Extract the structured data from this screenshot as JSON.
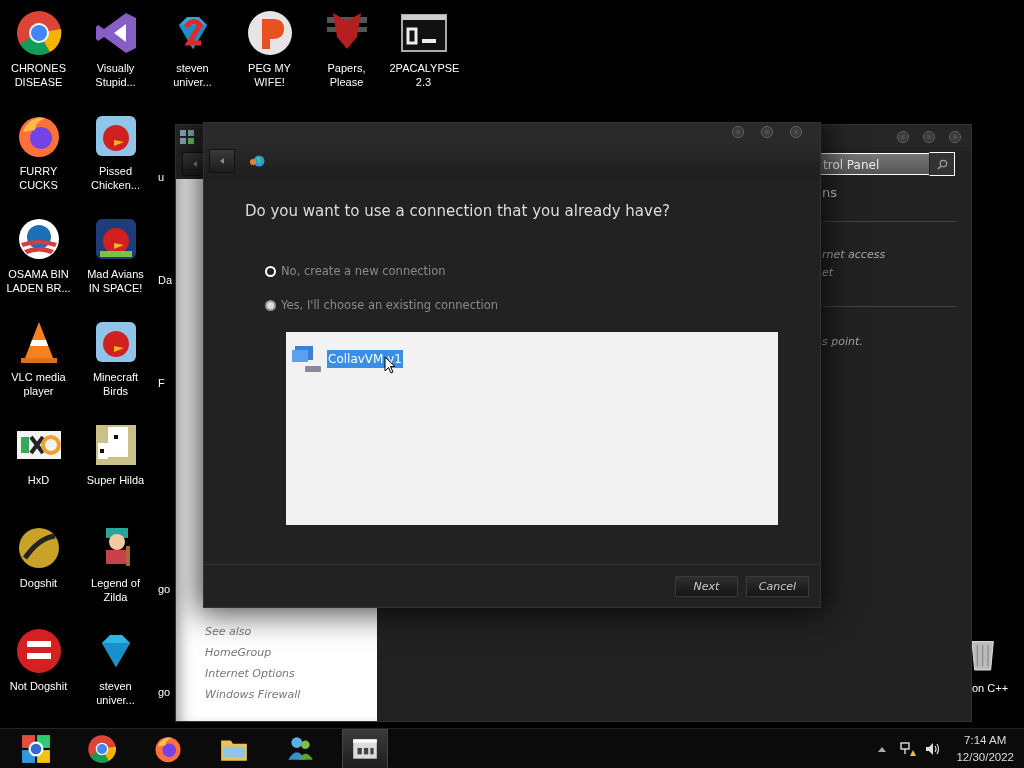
{
  "desktop": {
    "columns": [
      {
        "icons": [
          {
            "kind": "browser",
            "label": "CHRONES DISEASE"
          },
          {
            "kind": "fox",
            "label": "FURRY CUCKS"
          },
          {
            "kind": "stripes",
            "label": "OSAMA BIN LADEN BR..."
          },
          {
            "kind": "cone",
            "label": "VLC media player"
          },
          {
            "kind": "hex",
            "label": "HxD"
          },
          {
            "kind": "disc",
            "label": "Dogshit"
          },
          {
            "kind": "badge",
            "label": "Not Dogshit"
          }
        ]
      },
      {
        "icons": [
          {
            "kind": "ide",
            "label": "Visually Stupid..."
          },
          {
            "kind": "bird",
            "label": "Pissed Chicken..."
          },
          {
            "kind": "space-bird",
            "label": "Mad Avians IN SPACE!"
          },
          {
            "kind": "bird",
            "label": "Minecraft Birds"
          },
          {
            "kind": "pixel",
            "label": "Super Hilda"
          },
          {
            "kind": "figure",
            "label": "Legend of Zilda"
          },
          {
            "kind": "gem",
            "label": "steven univer..."
          }
        ]
      },
      {
        "icons": [
          {
            "kind": "gem2",
            "label": "steven univer..."
          },
          {
            "kind": "clipped",
            "label": "u"
          },
          {
            "kind": "clipped",
            "label": "Da"
          },
          {
            "kind": "clipped",
            "label": "F"
          },
          {
            "kind": "gap"
          },
          {
            "kind": "clipped",
            "label": "go"
          },
          {
            "kind": "clipped",
            "label": "go"
          }
        ]
      },
      {
        "icons": [
          {
            "kind": "ball",
            "label": "PEG MY WIFE!"
          }
        ]
      },
      {
        "icons": [
          {
            "kind": "emblem",
            "label": "Papers, Please"
          }
        ]
      },
      {
        "icons": [
          {
            "kind": "console",
            "label": "2PACALYPSE 2.3"
          }
        ]
      }
    ],
    "recycle_bin": {
      "label": "on C++"
    }
  },
  "control_panel": {
    "search": {
      "value": "trol Panel"
    },
    "heading": "ns",
    "links": [
      "rnet access",
      "et"
    ],
    "note": "s point.",
    "see_also": {
      "title": "See also",
      "links": [
        "HomeGroup",
        "Internet Options",
        "Windows Firewall"
      ]
    }
  },
  "dialog": {
    "question": "Do you want to use a connection that you already have?",
    "options": [
      {
        "label": "No, create a new connection",
        "selected": false
      },
      {
        "label": "Yes, I'll choose an existing connection",
        "selected": true
      }
    ],
    "connections": [
      {
        "name": "CollavVM v1",
        "selected": true
      }
    ],
    "buttons": [
      {
        "label": "Next"
      },
      {
        "label": "Cancel"
      }
    ]
  },
  "taskbar": {
    "items": [
      {
        "kind": "start",
        "active": false
      },
      {
        "kind": "browser",
        "active": false
      },
      {
        "kind": "fox",
        "active": false
      },
      {
        "kind": "folder",
        "active": false
      },
      {
        "kind": "messenger",
        "active": false
      },
      {
        "kind": "panel",
        "active": true
      }
    ],
    "clock": {
      "time": "7:14 AM",
      "date": "12/30/2022"
    }
  }
}
